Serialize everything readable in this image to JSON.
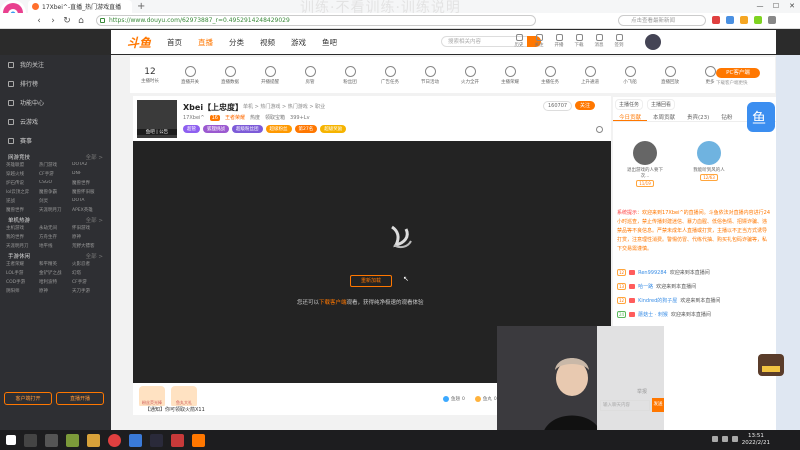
{
  "browser": {
    "tab_title": "17Xbei^-直播_热门游戏直播",
    "new_tab": "+",
    "url": "https://www.douyu.com/62973887_r=0.4952914248429029",
    "web_search_placeholder": "点击查看最新新闻",
    "window_controls": [
      "—",
      "☐",
      "✕"
    ],
    "overlay_text": "训练·不看训练·训练说明"
  },
  "site": {
    "logo": "斗鱼",
    "nav": [
      "首页",
      "直播",
      "分类",
      "视频",
      "游戏",
      "鱼吧"
    ],
    "active_nav": "直播",
    "search_placeholder": "搜索相关内容",
    "header_icons": [
      "历史",
      "关注",
      "开播",
      "下载",
      "消息",
      "签到"
    ]
  },
  "sidebar": {
    "top": [
      "我的关注",
      "排行榜",
      "功能中心",
      "云游戏",
      "赛事"
    ],
    "sections": [
      {
        "title": "网游竞技",
        "more": "全部 >",
        "items": [
          "英雄联盟",
          "热门游戏",
          "DOTA2",
          "穿越火线",
          "CF手游",
          "DNF",
          "炉石传说",
          "CSGO",
          "魔兽世界",
          "lol云顶之弈",
          "魔兽争霸",
          "魔兽怀旧服",
          "逆战",
          "剑灵",
          "DOTA",
          "魔兽世界",
          "天涯明月刀",
          "APEX英雄"
        ]
      },
      {
        "title": "单机热游",
        "more": "全部 >",
        "items": [
          "主机游戏",
          "永劫无间",
          "怀旧游戏",
          "我的世界",
          "方舟生存",
          "原神",
          "天涯明月刀",
          "地平线",
          "荒野大镖客"
        ]
      },
      {
        "title": "手游休闲",
        "more": "全部 >",
        "items": [
          "王者荣耀",
          "和平精英",
          "火影忍者",
          "LOL手游",
          "金铲铲之战",
          "幻塔",
          "COD手游",
          "哈利波特",
          "CF手游",
          "阴阳师",
          "原神",
          "天刀手游"
        ]
      }
    ],
    "footer": [
      "客户端打开",
      "直播开播"
    ]
  },
  "category_bar": {
    "items": [
      {
        "num": "12",
        "label": "主播时长"
      },
      {
        "num": "",
        "label": "直播开关"
      },
      {
        "num": "",
        "label": "直播数据"
      },
      {
        "num": "",
        "label": "开播提醒"
      },
      {
        "num": "",
        "label": "房管"
      },
      {
        "num": "",
        "label": "粉丝团"
      },
      {
        "num": "",
        "label": "广告任务"
      },
      {
        "num": "",
        "label": "节日活动"
      },
      {
        "num": "",
        "label": "火力全开"
      },
      {
        "num": "",
        "label": "主播荣耀"
      },
      {
        "num": "",
        "label": "主播任务"
      },
      {
        "num": "",
        "label": "上升通道"
      },
      {
        "num": "",
        "label": "小飞船"
      },
      {
        "num": "",
        "label": "直播回放"
      },
      {
        "num": "",
        "label": "更多"
      }
    ],
    "pc_button": "PC客户端",
    "pc_sub": "下载客户端更快"
  },
  "room": {
    "title": "Xbei【上忠度】",
    "crumbs": "单机 > 热门游戏 > 热门游戏 > 职业",
    "meta": [
      "17Xbei^",
      "16",
      "王者荣耀",
      "热度",
      "领取宝箱",
      "399+Lv"
    ],
    "badges": [
      {
        "text": "超管",
        "color": "#8e5ff0"
      },
      {
        "text": "狐狸挑战",
        "color": "#9b59d0"
      },
      {
        "text": "超级粉丝团",
        "color": "#7d5bd8"
      },
      {
        "text": "超级粉丝",
        "color": "#ff9900"
      },
      {
        "text": "第27名",
        "color": "#ff7700"
      },
      {
        "text": "超级奖励",
        "color": "#f6b400"
      }
    ],
    "followers": "160707",
    "follow_button": "关注",
    "avatar_labels": "鱼吧 | 公告"
  },
  "video": {
    "retry_button": "重新加载",
    "tip_prefix": "您还可以",
    "tip_link": "下载客户端",
    "tip_suffix": "观看，获得纯净极速的观看体验",
    "cursor": "↖"
  },
  "giftbar": {
    "gifts": [
      "粉丝荧光棒",
      "鱼丸大礼"
    ],
    "balances": [
      {
        "name": "鱼翅",
        "value": "0"
      },
      {
        "name": "鱼丸",
        "value": "0"
      }
    ],
    "bottom_tip": "【通知】你可领取火箭X11"
  },
  "chat": {
    "header_tabs": [
      "主播任务",
      "主播回看"
    ],
    "tabs": [
      "今日贡献",
      "本周贡献",
      "贵宾(23)",
      "钻粉"
    ],
    "active_tab": "今日贡献",
    "top_users": [
      {
        "name": "退出游戏的人要下次...",
        "tag": "11/19"
      },
      {
        "name": "我能听到风的人",
        "tag": "12/63"
      }
    ],
    "system_label": "系统提示",
    "system_msg": "欢迎来到17Xbei^的直播间。斗鱼依法对直播内容进行24小时巡查，禁止传播封建迷信、暴力血腥、低俗色情、招嫖诈骗、违禁品等不良信息。严禁未成年人直播或打赏，主播以不正当方式诱导打赏，注意理性消费。警惕仿冒、代练代抽、购买礼包码诈骗等，私下交易需谨慎。",
    "messages": [
      {
        "lv": "12",
        "name": "Ren999284",
        "text": "欢迎来到本直播间",
        "green": false
      },
      {
        "lv": "13",
        "name": "哈一路",
        "text": "欢迎来到本直播间",
        "green": false
      },
      {
        "lv": "12",
        "name": "Kindred的狗子屋",
        "text": "欢迎来到本直播间",
        "green": false
      },
      {
        "lv": "24",
        "name": "蘑菇士 · 刺猴",
        "text": "欢迎来到本直播间",
        "green": true
      }
    ],
    "send_placeholder": "输入聊天内容",
    "send_button": "发送",
    "report": "举报"
  },
  "taskbar": {
    "time": "13:51",
    "date": "2022/2/21"
  },
  "colors": {
    "accent": "#ff7700",
    "sidebar_bg": "#2e2f33",
    "video_bg": "#232323",
    "taskbar_bg": "#1d1d1f"
  }
}
